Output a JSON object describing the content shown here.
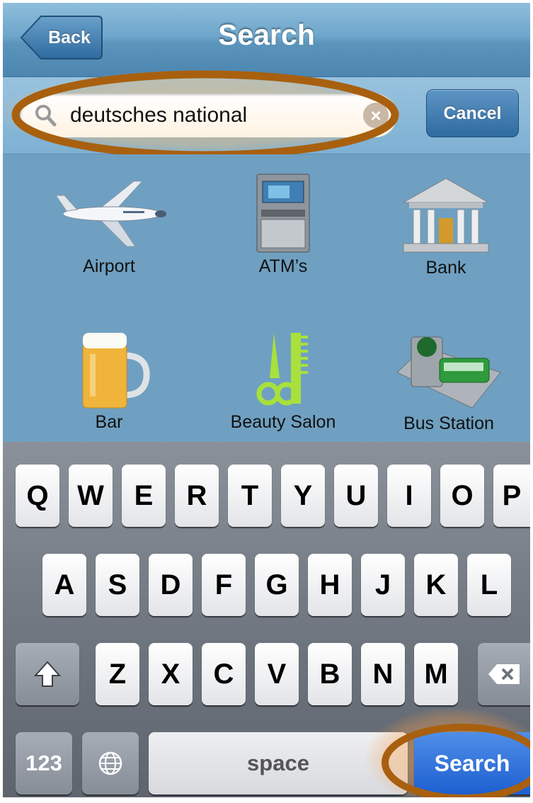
{
  "navbar": {
    "back_label": "Back",
    "title": "Search"
  },
  "search": {
    "value": "deutsches national",
    "cancel_label": "Cancel",
    "clear_icon": "clear-icon",
    "search_icon": "magnifier-icon"
  },
  "categories": [
    {
      "label": "Airport",
      "icon": "airplane-icon"
    },
    {
      "label": "ATM’s",
      "icon": "atm-icon"
    },
    {
      "label": "Bank",
      "icon": "bank-icon"
    },
    {
      "label": "Bar",
      "icon": "beer-mug-icon"
    },
    {
      "label": "Beauty Salon",
      "icon": "comb-scissors-icon"
    },
    {
      "label": "Bus Station",
      "icon": "bus-stop-icon"
    }
  ],
  "keyboard": {
    "row1": [
      "Q",
      "W",
      "E",
      "R",
      "T",
      "Y",
      "U",
      "I",
      "O",
      "P"
    ],
    "row2": [
      "A",
      "S",
      "D",
      "F",
      "G",
      "H",
      "J",
      "K",
      "L"
    ],
    "row3": [
      "Z",
      "X",
      "C",
      "V",
      "B",
      "N",
      "M"
    ],
    "numbers_label": "123",
    "space_label": "space",
    "go_label": "Search"
  },
  "colors": {
    "highlight": "#a8600f",
    "nav_blue": "#5b94bb",
    "go_key": "#1d5fd0"
  }
}
